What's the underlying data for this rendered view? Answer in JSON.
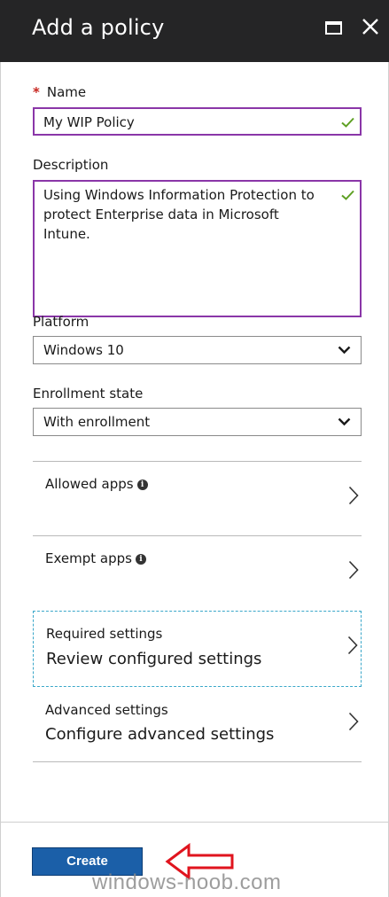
{
  "window": {
    "title": "Add a policy",
    "maximize_icon": "maximize-icon",
    "close_icon": "close-icon"
  },
  "form": {
    "name": {
      "required_marker": "*",
      "label": "Name",
      "value": "My WIP Policy",
      "valid": true
    },
    "description": {
      "label": "Description",
      "value": "Using Windows Information Protection to protect Enterprise data in Microsoft Intune.",
      "valid": true
    },
    "platform": {
      "label": "Platform",
      "value": "Windows 10"
    },
    "enrollment_state": {
      "label": "Enrollment state",
      "value": "With enrollment"
    }
  },
  "sections": {
    "allowed_apps": {
      "label": "Allowed apps",
      "info_icon": "info-icon"
    },
    "exempt_apps": {
      "label": "Exempt apps",
      "info_icon": "info-icon"
    },
    "required_settings": {
      "label": "Required settings",
      "value": "Review configured settings"
    },
    "advanced_settings": {
      "label": "Advanced settings",
      "value": "Configure advanced settings"
    }
  },
  "footer": {
    "create_label": "Create"
  },
  "annotation": {
    "arrow_icon": "red-arrow-icon",
    "watermark": "windows-noob.com"
  },
  "colors": {
    "title_bar": "#252526",
    "focus_border": "#8a36a8",
    "valid_check": "#5ea023",
    "primary_button": "#1b5fa8",
    "required_marker": "#c7261f",
    "dashed_focus": "#3aa7c9",
    "annotation_arrow": "#e0141e"
  }
}
